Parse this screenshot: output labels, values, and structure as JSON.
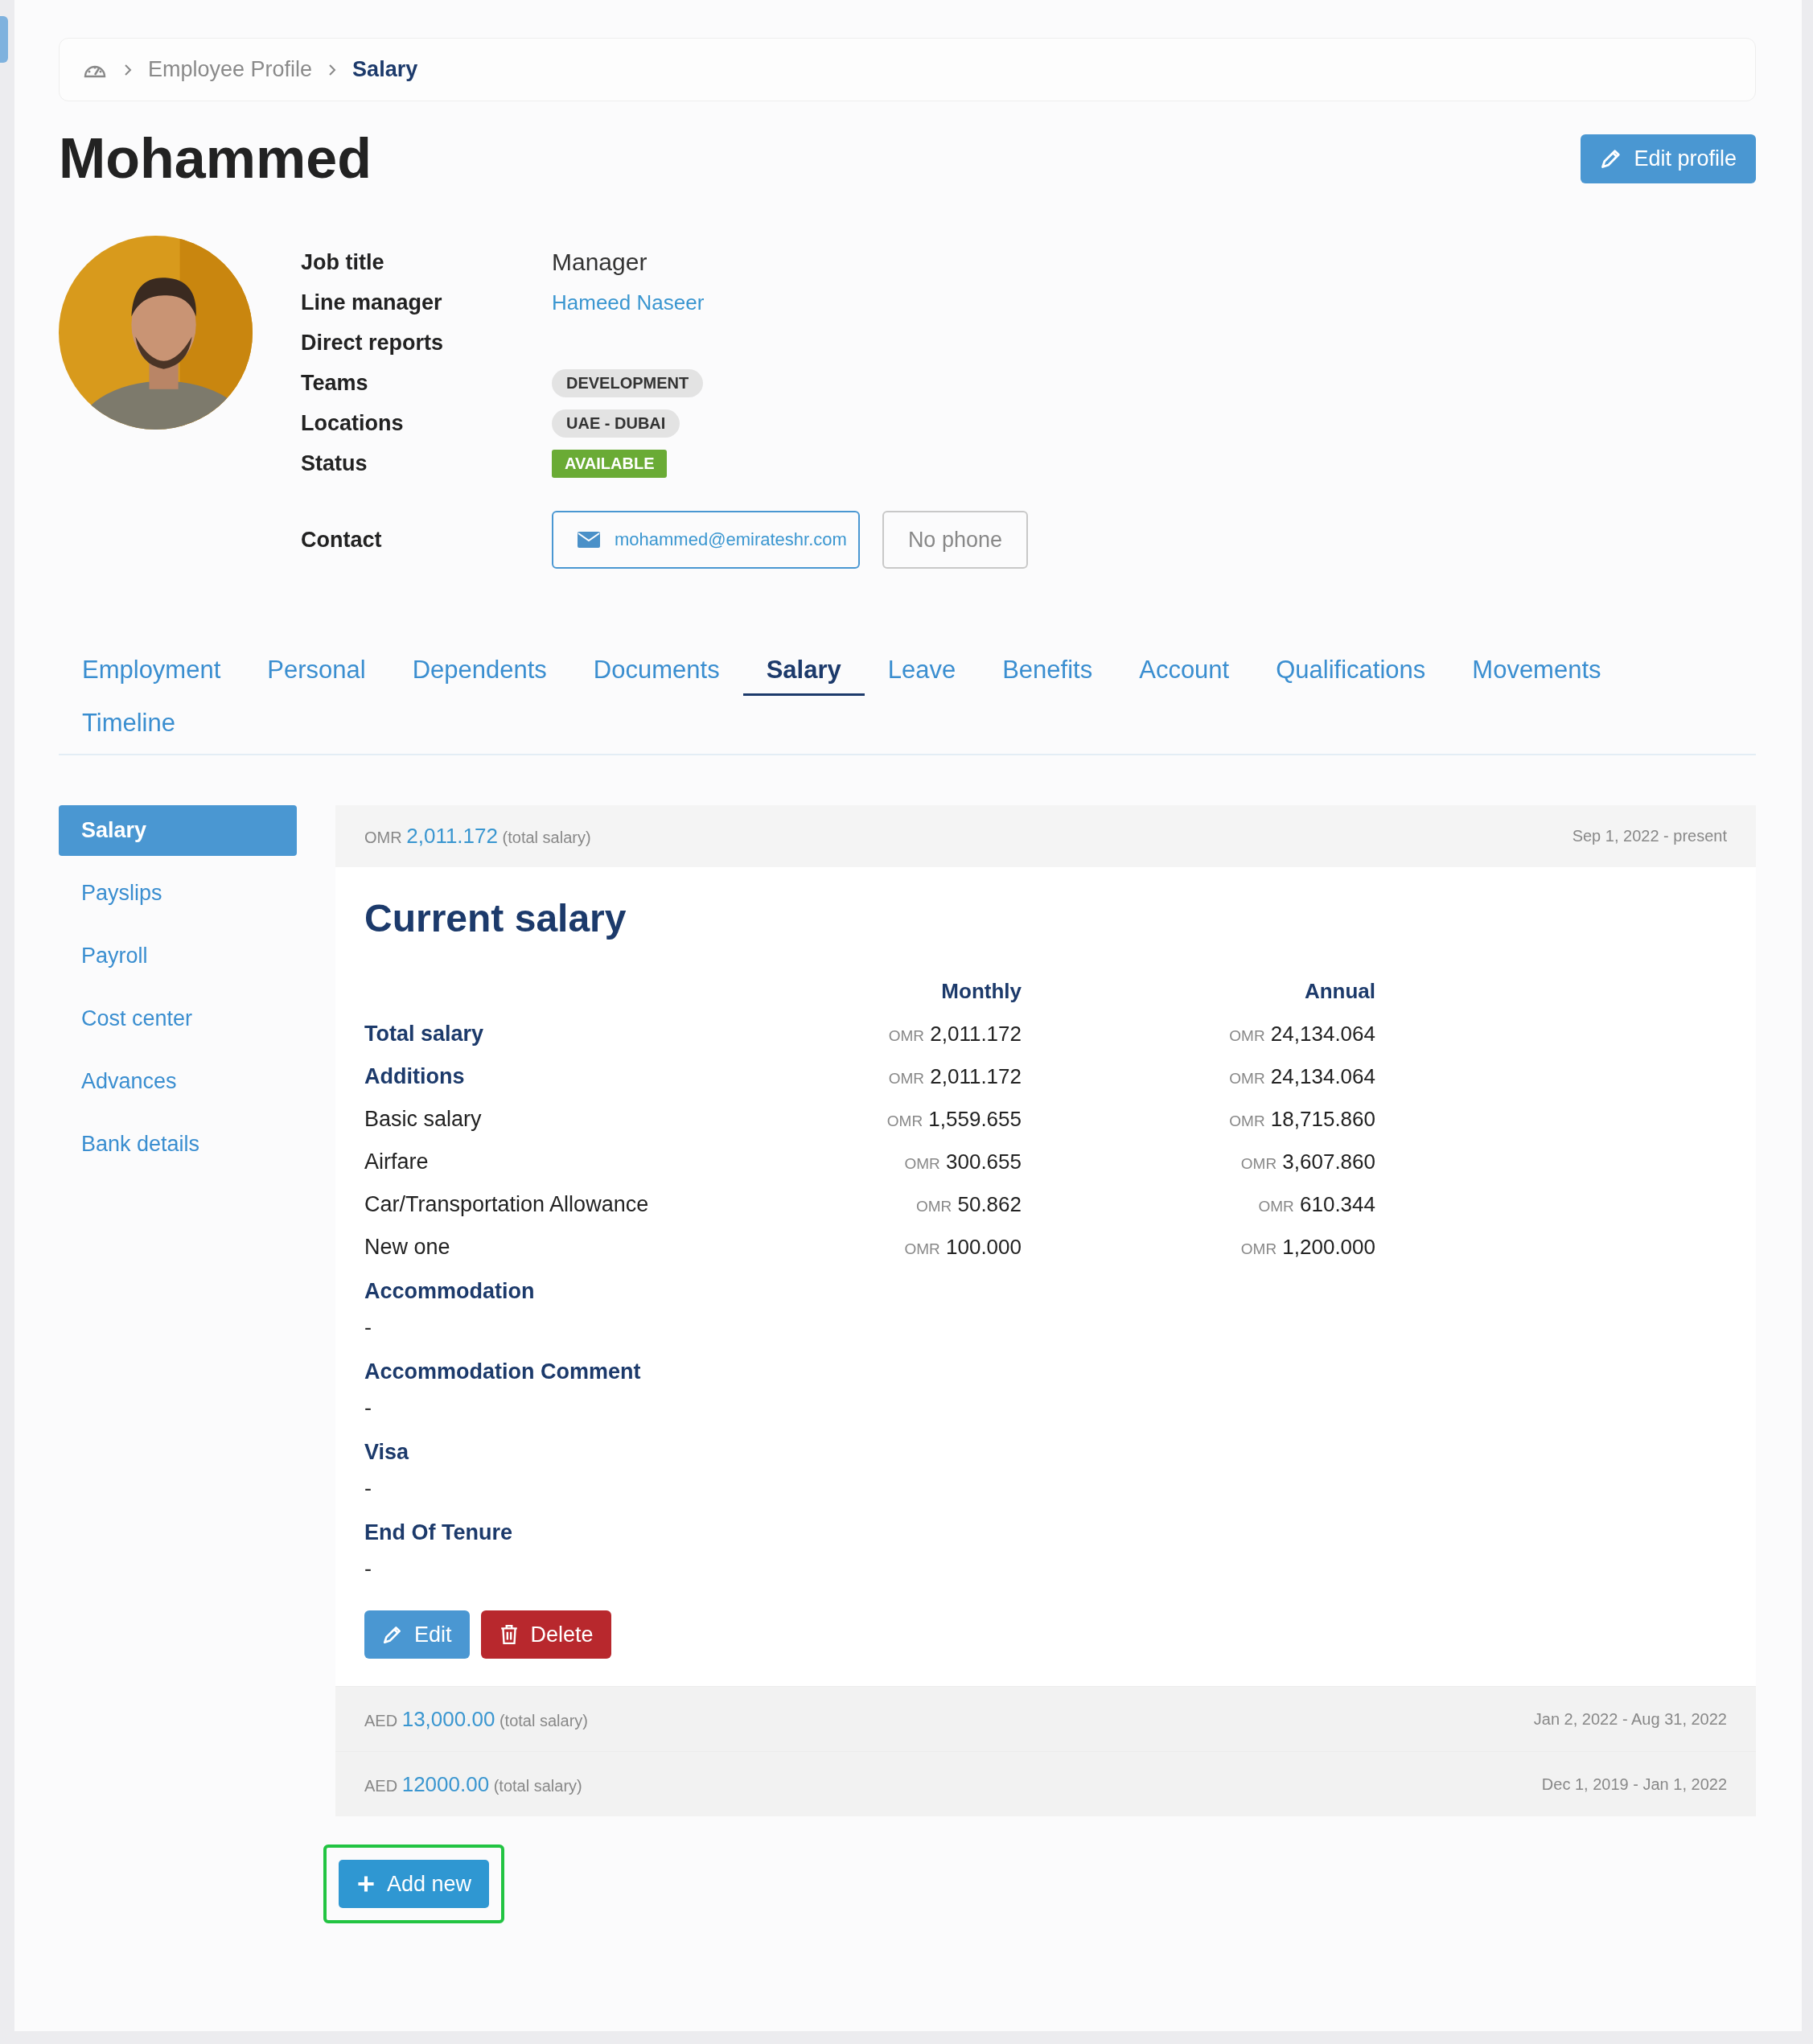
{
  "breadcrumb": [
    {
      "label": "Employee Profile",
      "current": false
    },
    {
      "label": "Salary",
      "current": true
    }
  ],
  "profile": {
    "name": "Mohammed",
    "edit_button": "Edit profile"
  },
  "details": [
    {
      "label": "Job title",
      "kind": "text",
      "value": "Manager"
    },
    {
      "label": "Line manager",
      "kind": "link",
      "value": "Hameed Naseer"
    },
    {
      "label": "Direct reports",
      "kind": "empty"
    },
    {
      "label": "Teams",
      "kind": "tag",
      "value": "DEVELOPMENT",
      "color": "#e3e3e3"
    },
    {
      "label": "Locations",
      "kind": "tag",
      "value": "UAE - DUBAI",
      "color": "#e3e3e3"
    },
    {
      "label": "Status",
      "kind": "status",
      "value": "AVAILABLE",
      "color": "#6aab35"
    }
  ],
  "contact": {
    "label": "Contact",
    "email": "mohammed@emirateshr.com",
    "phone": "No phone"
  },
  "tabs": [
    {
      "label": "Employment",
      "selected": false
    },
    {
      "label": "Personal",
      "selected": false
    },
    {
      "label": "Dependents",
      "selected": false
    },
    {
      "label": "Documents",
      "selected": false
    },
    {
      "label": "Salary",
      "selected": true
    },
    {
      "label": "Leave",
      "selected": false
    },
    {
      "label": "Benefits",
      "selected": false
    },
    {
      "label": "Account",
      "selected": false
    },
    {
      "label": "Qualifications",
      "selected": false
    },
    {
      "label": "Movements",
      "selected": false
    },
    {
      "label": "Timeline",
      "selected": false
    }
  ],
  "side_nav": [
    {
      "label": "Salary",
      "selected": true
    },
    {
      "label": "Payslips",
      "selected": false
    },
    {
      "label": "Payroll",
      "selected": false
    },
    {
      "label": "Cost center",
      "selected": false
    },
    {
      "label": "Advances",
      "selected": false
    },
    {
      "label": "Bank details",
      "selected": false
    }
  ],
  "current": {
    "currency": "OMR",
    "amount": "2,011.172",
    "note": "(total salary)",
    "period": "Sep 1, 2022 - present",
    "title": "Current salary",
    "columns": [
      "Monthly",
      "Annual"
    ],
    "rows": [
      {
        "kind": "heading",
        "label": "Total salary",
        "monthly_currency": "OMR",
        "monthly": "2,011.172",
        "annual_currency": "OMR",
        "annual": "24,134.064"
      },
      {
        "kind": "heading",
        "label": "Additions",
        "monthly_currency": "OMR",
        "monthly": "2,011.172",
        "annual_currency": "OMR",
        "annual": "24,134.064"
      },
      {
        "kind": "item",
        "label": "Basic salary",
        "monthly_currency": "OMR",
        "monthly": "1,559.655",
        "annual_currency": "OMR",
        "annual": "18,715.860"
      },
      {
        "kind": "item",
        "label": "Airfare",
        "monthly_currency": "OMR",
        "monthly": "300.655",
        "annual_currency": "OMR",
        "annual": "3,607.860"
      },
      {
        "kind": "item",
        "label": "Car/Transportation Allowance",
        "monthly_currency": "OMR",
        "monthly": "50.862",
        "annual_currency": "OMR",
        "annual": "610.344"
      },
      {
        "kind": "item",
        "label": "New one",
        "monthly_currency": "OMR",
        "monthly": "100.000",
        "annual_currency": "OMR",
        "annual": "1,200.000"
      }
    ],
    "fields": [
      {
        "label": "Accommodation",
        "value": "-"
      },
      {
        "label": "Accommodation Comment",
        "value": "-"
      },
      {
        "label": "Visa",
        "value": "-"
      },
      {
        "label": "End Of Tenure",
        "value": "-"
      }
    ],
    "edit_button": "Edit",
    "delete_button": "Delete"
  },
  "history": [
    {
      "currency": "AED",
      "amount": "13,000.00",
      "note": "(total salary)",
      "period": "Jan 2, 2022 - Aug 31, 2022"
    },
    {
      "currency": "AED",
      "amount": "12000.00",
      "note": "(total salary)",
      "period": "Dec 1, 2019 - Jan 1, 2022"
    }
  ],
  "add_button": {
    "label": "Add new",
    "highlighted": true
  }
}
